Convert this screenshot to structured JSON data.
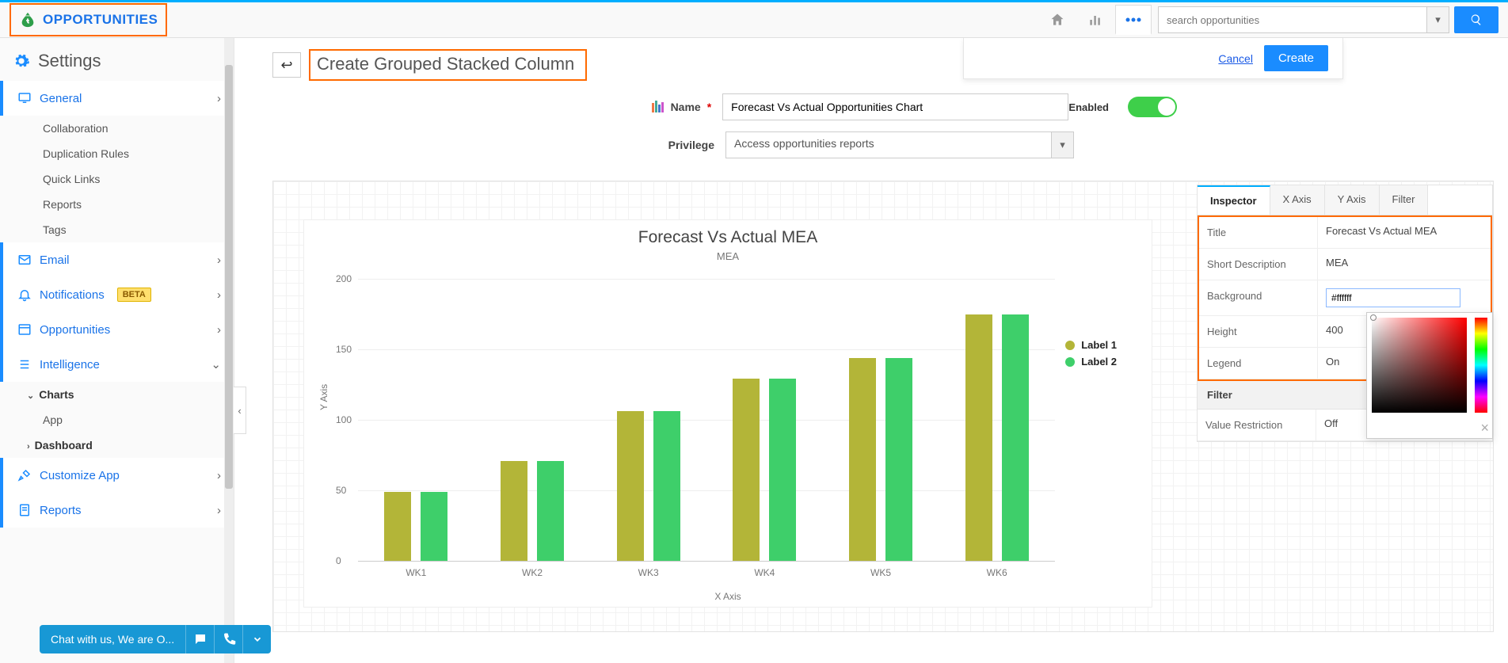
{
  "top": {
    "brand": "OPPORTUNITIES",
    "search_placeholder": "search opportunities"
  },
  "actions": {
    "cancel": "Cancel",
    "create": "Create"
  },
  "sidebar": {
    "settings": "Settings",
    "general": "General",
    "general_items": [
      "Collaboration",
      "Duplication Rules",
      "Quick Links",
      "Reports",
      "Tags"
    ],
    "email": "Email",
    "notifications": "Notifications",
    "beta": "BETA",
    "opportunities": "Opportunities",
    "intelligence": "Intelligence",
    "charts": "Charts",
    "app": "App",
    "dashboard": "Dashboard",
    "customize": "Customize App",
    "reports2": "Reports"
  },
  "page": {
    "title": "Create Grouped Stacked Column",
    "name_label": "Name",
    "name_value": "Forecast Vs Actual Opportunities Chart",
    "privilege_label": "Privilege",
    "privilege_value": "Access opportunities reports",
    "enabled_label": "Enabled"
  },
  "inspector": {
    "tabs": [
      "Inspector",
      "X Axis",
      "Y Axis",
      "Filter"
    ],
    "rows": {
      "title_l": "Title",
      "title_v": "Forecast Vs Actual MEA",
      "desc_l": "Short Description",
      "desc_v": "MEA",
      "bg_l": "Background",
      "bg_v": "#ffffff",
      "height_l": "Height",
      "height_v": "400",
      "legend_l": "Legend",
      "legend_v": "On",
      "filter_hdr": "Filter",
      "vr_l": "Value Restriction",
      "vr_v": "Off"
    }
  },
  "chat": {
    "text": "Chat with us, We are O..."
  },
  "chart_data": {
    "type": "bar",
    "title": "Forecast Vs Actual MEA",
    "subtitle": "MEA",
    "xlabel": "X Axis",
    "ylabel": "Y Axis",
    "ylim": [
      0,
      200
    ],
    "yticks": [
      0,
      50,
      100,
      150,
      200
    ],
    "categories": [
      "WK1",
      "WK2",
      "WK3",
      "WK4",
      "WK5",
      "WK6"
    ],
    "series": [
      {
        "name": "Label 1",
        "color": "#b3b538",
        "values": [
          49,
          71,
          106,
          129,
          144,
          175
        ]
      },
      {
        "name": "Label 2",
        "color": "#3ecf6a",
        "values": [
          49,
          71,
          106,
          129,
          144,
          175
        ]
      }
    ]
  }
}
